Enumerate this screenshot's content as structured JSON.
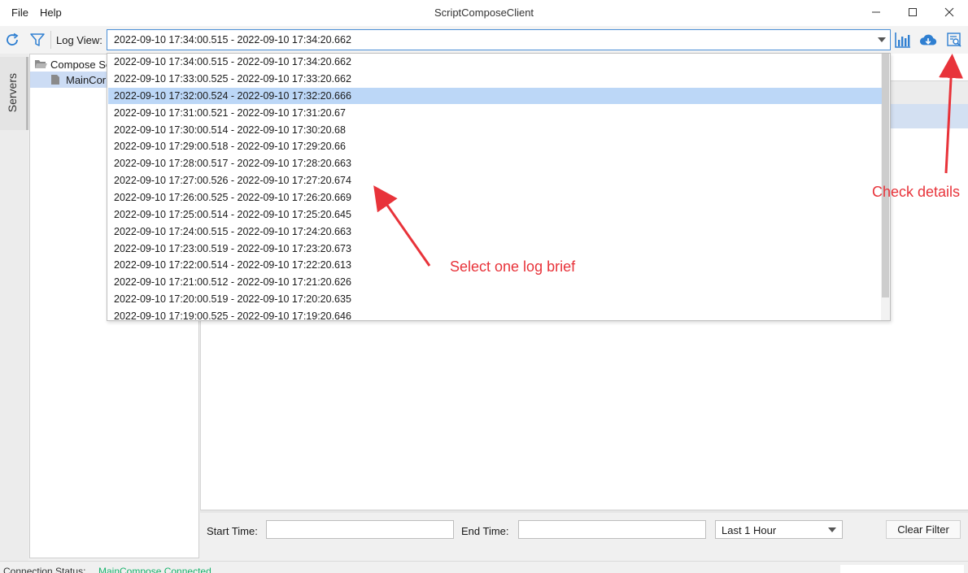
{
  "titlebar": {
    "title": "ScriptComposeClient",
    "menu": [
      "File",
      "Help"
    ]
  },
  "toolbar": {
    "log_view_label": "Log View:",
    "selected_log": "2022-09-10 17:34:00.515 - 2022-09-10 17:34:20.662",
    "icons": [
      "refresh-icon",
      "filter-icon",
      "chart-icon",
      "cloud-download-icon",
      "check-details-icon"
    ]
  },
  "sidetab": {
    "label": "Servers"
  },
  "tree": {
    "root": "Compose Se",
    "child": "MainCor"
  },
  "dropdown": {
    "items": [
      "2022-09-10 17:34:00.515 - 2022-09-10 17:34:20.662",
      "2022-09-10 17:33:00.525 - 2022-09-10 17:33:20.662",
      "2022-09-10 17:32:00.524 - 2022-09-10 17:32:20.666",
      "2022-09-10 17:31:00.521 - 2022-09-10 17:31:20.67",
      "2022-09-10 17:30:00.514 - 2022-09-10 17:30:20.68",
      "2022-09-10 17:29:00.518 - 2022-09-10 17:29:20.66",
      "2022-09-10 17:28:00.517 - 2022-09-10 17:28:20.663",
      "2022-09-10 17:27:00.526 - 2022-09-10 17:27:20.674",
      "2022-09-10 17:26:00.525 - 2022-09-10 17:26:20.669",
      "2022-09-10 17:25:00.514 - 2022-09-10 17:25:20.645",
      "2022-09-10 17:24:00.515 - 2022-09-10 17:24:20.663",
      "2022-09-10 17:23:00.519 - 2022-09-10 17:23:20.673",
      "2022-09-10 17:22:00.514 - 2022-09-10 17:22:20.613",
      "2022-09-10 17:21:00.512 - 2022-09-10 17:21:20.626",
      "2022-09-10 17:20:00.519 - 2022-09-10 17:20:20.635",
      "2022-09-10 17:19:00.525 - 2022-09-10 17:19:20.646"
    ],
    "selected_index": 2
  },
  "filter": {
    "start_label": "Start Time:",
    "start_value": "",
    "end_label": "End Time:",
    "end_value": "",
    "range_selected": "Last 1 Hour",
    "clear_label": "Clear Filter"
  },
  "status": {
    "label": "Connection Status:",
    "value": "MainCompose Connected"
  },
  "annotations": {
    "select_hint": "Select one log brief",
    "details_hint": "Check details"
  },
  "colors": {
    "accent": "#4a8fd6",
    "selection": "#bcd7f7",
    "annotation": "#e8333a",
    "status_ok": "#18b26b"
  }
}
